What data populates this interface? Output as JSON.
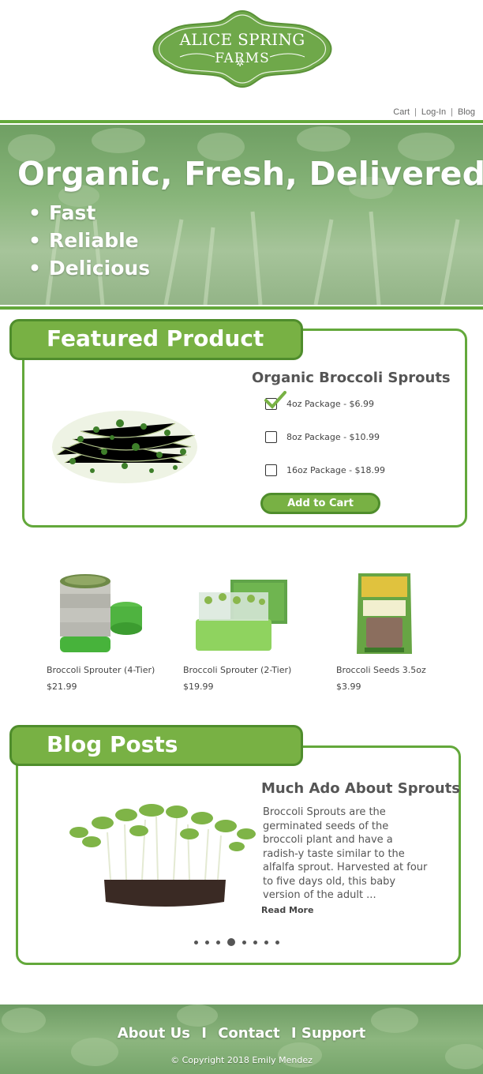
{
  "logo": {
    "line1": "ALICE SPRING",
    "line2": "FARMS"
  },
  "top_nav": {
    "cart": "Cart",
    "login": "Log-In",
    "blog": "Blog",
    "separator": "|"
  },
  "hero": {
    "title": "Organic, Fresh, Delivered",
    "bullets": [
      "Fast",
      "Reliable",
      "Delicious"
    ]
  },
  "featured": {
    "tab_label": "Featured Product",
    "product_title": "Organic Broccoli Sprouts",
    "options": [
      {
        "label": "4oz Package - $6.99",
        "checked": true
      },
      {
        "label": "8oz Package - $10.99",
        "checked": false
      },
      {
        "label": "16oz Package - $18.99",
        "checked": false
      }
    ],
    "add_to_cart": "Add to Cart"
  },
  "products": [
    {
      "name": "Broccoli Sprouter (4-Tier)",
      "price": "$21.99"
    },
    {
      "name": "Broccoli Sprouter (2-Tier)",
      "price": "$19.99"
    },
    {
      "name": "Broccoli Seeds 3.5oz",
      "price": "$3.99"
    }
  ],
  "blog": {
    "tab_label": "Blog Posts",
    "post_title": "Much Ado About Sprouts",
    "post_excerpt": "Broccoli Sprouts are the germinated seeds of the broccoli plant and have a radish-y taste similar to the alfalfa sprout. Harvested at four to five days old, this baby version of the adult ...",
    "read_more": "Read More",
    "carousel": {
      "total": 8,
      "active": 4
    }
  },
  "footer": {
    "about": "About Us",
    "contact": "Contact",
    "support": "I Support",
    "sep": "I",
    "copyright": "© Copyright 2018 Emily Mendez"
  },
  "colors": {
    "accent": "#78b144",
    "accent_dark": "#4f8d2c",
    "rule": "#63a83b"
  }
}
